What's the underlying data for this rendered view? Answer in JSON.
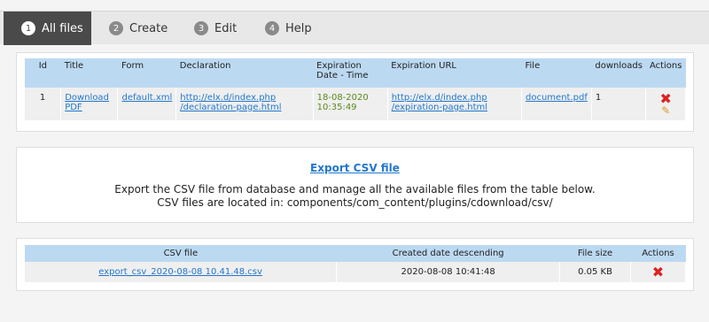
{
  "tabs": [
    {
      "num": "1",
      "label": "All files"
    },
    {
      "num": "2",
      "label": "Create"
    },
    {
      "num": "3",
      "label": "Edit"
    },
    {
      "num": "4",
      "label": "Help"
    }
  ],
  "files_table": {
    "headers": {
      "id": "Id",
      "title": "Title",
      "form": "Form",
      "declaration": "Declaration",
      "expiration_date": "Expiration Date - Time",
      "expiration_url": "Expiration URL",
      "file": "File",
      "downloads": "downloads",
      "actions": "Actions"
    },
    "rows": [
      {
        "id": "1",
        "title": "Download PDF",
        "form": "default.xml",
        "declaration": "http://elx.d/index.php /declaration-page.html",
        "expiration_date": "18-08-2020 10:35:49",
        "expiration_url": "http://elx.d/index.php /expiration-page.html",
        "file": "document.pdf",
        "downloads": "1"
      }
    ]
  },
  "export": {
    "link_label": "Export CSV file",
    "description_line1": "Export the CSV file from database and manage all the available files from the table below.",
    "description_line2": "CSV files are located in: components/com_content/plugins/cdownload/csv/"
  },
  "csv_table": {
    "headers": {
      "csv_file": "CSV file",
      "created": "Created date descending",
      "size": "File size",
      "actions": "Actions"
    },
    "rows": [
      {
        "file": "export_csv_2020-08-08 10.41.48.csv",
        "created": "2020-08-08 10:41:48",
        "size": "0.05 KB"
      }
    ]
  },
  "colors": {
    "header_blue": "#bcd9f2",
    "link": "#2277cc",
    "delete_red": "#dd2222",
    "date_green": "#5a8a1a"
  }
}
